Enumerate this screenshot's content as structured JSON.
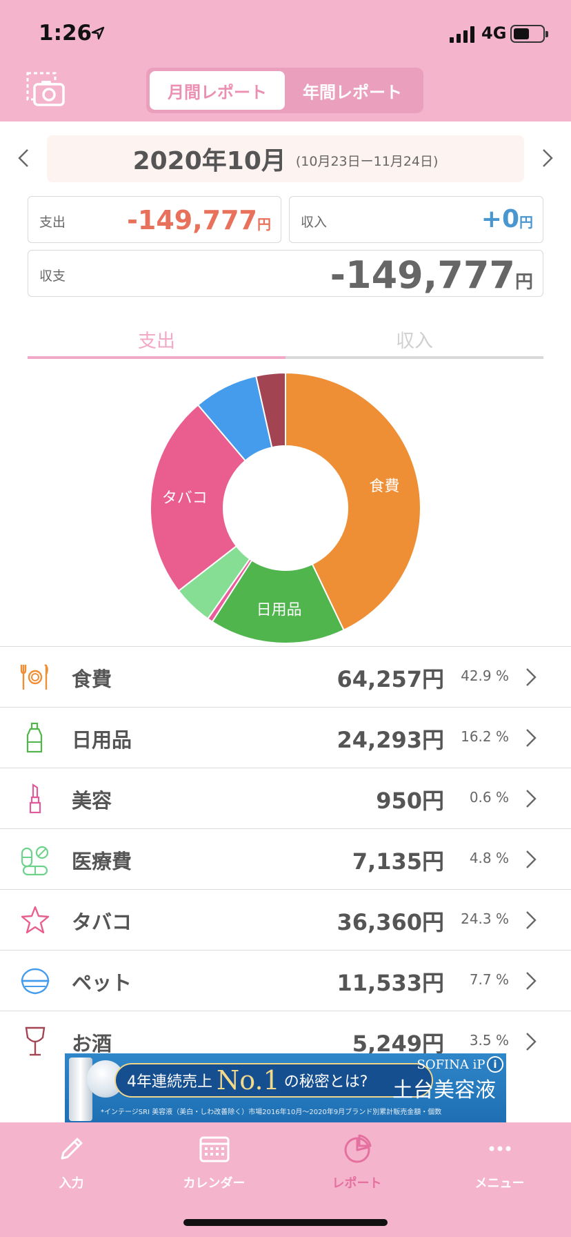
{
  "status_bar": {
    "time": "1:26",
    "network": "4G"
  },
  "header": {
    "segments": [
      {
        "label": "月間レポート",
        "active": true
      },
      {
        "label": "年間レポート",
        "active": false
      }
    ]
  },
  "period": {
    "month": "2020年10月",
    "range": "(10月23日ー11月24日)"
  },
  "summary": {
    "expense_label": "支出",
    "expense_value": "-149,777",
    "income_label": "収入",
    "income_value": "+0",
    "balance_label": "収支",
    "balance_value": "-149,777",
    "currency": "円"
  },
  "type_tabs": [
    {
      "label": "支出",
      "active": true
    },
    {
      "label": "収入",
      "active": false
    }
  ],
  "chart_data": {
    "type": "pie",
    "categories": [
      "食費",
      "日用品",
      "美容",
      "医療費",
      "タバコ",
      "ペット",
      "お酒"
    ],
    "values": [
      64257,
      24293,
      950,
      7135,
      36360,
      11533,
      5249
    ],
    "percents": [
      42.9,
      16.2,
      0.6,
      4.8,
      24.3,
      7.7,
      3.5
    ],
    "colors": [
      "#ef8f35",
      "#4fb54c",
      "#ea5d9a",
      "#86de95",
      "#ea5e8f",
      "#459cec",
      "#a34453"
    ],
    "slice_labels": [
      "食費",
      "日用品",
      "",
      "",
      "タバコ",
      "",
      ""
    ]
  },
  "categories": [
    {
      "name": "食費",
      "amount": "64,257円",
      "percent": "42.9 %",
      "icon": "dining-icon",
      "color": "#ef8f35"
    },
    {
      "name": "日用品",
      "amount": "24,293円",
      "percent": "16.2 %",
      "icon": "bottle-icon",
      "color": "#4fb54c"
    },
    {
      "name": "美容",
      "amount": "950円",
      "percent": "0.6 %",
      "icon": "lipstick-icon",
      "color": "#e05b9a"
    },
    {
      "name": "医療費",
      "amount": "7,135円",
      "percent": "4.8 %",
      "icon": "pills-icon",
      "color": "#6dd38a"
    },
    {
      "name": "タバコ",
      "amount": "36,360円",
      "percent": "24.3 %",
      "icon": "star-icon",
      "color": "#ea5e8f"
    },
    {
      "name": "ペット",
      "amount": "11,533円",
      "percent": "7.7 %",
      "icon": "pet-bowl-icon",
      "color": "#459cec"
    },
    {
      "name": "お酒",
      "amount": "5,249円",
      "percent": "3.5 %",
      "icon": "wine-glass-icon",
      "color": "#a34453"
    }
  ],
  "ad": {
    "headline_pre": "4年連続売上",
    "headline_no1": "No.1",
    "headline_post": "の秘密とは?",
    "brand": "SOFINA iP",
    "product": "土台美容液",
    "fine_print": "*インテージSRI 美容液（美白・しわ改善除く）市場2016年10月〜2020年9月ブランド別累計販売金額・個数",
    "info": "i"
  },
  "bottom_nav": [
    {
      "label": "入力",
      "icon": "pencil-icon",
      "active": false
    },
    {
      "label": "カレンダー",
      "icon": "calendar-icon",
      "active": false
    },
    {
      "label": "レポート",
      "icon": "pie-chart-icon",
      "active": true
    },
    {
      "label": "メニュー",
      "icon": "more-icon",
      "active": false
    }
  ],
  "theme": {
    "primary": "#f4b5cc",
    "accent": "#e56f9f",
    "expense": "#e8715b",
    "income": "#4a96cf"
  }
}
